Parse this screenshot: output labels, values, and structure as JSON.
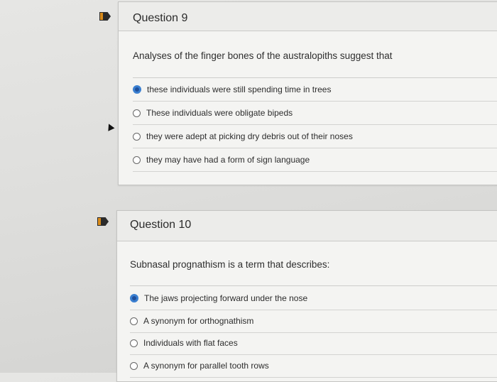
{
  "questions": [
    {
      "title": "Question 9",
      "prompt": "Analyses of the finger bones of the australopiths suggest that",
      "selected_index": 0,
      "options": [
        {
          "label": "these individuals were still spending time in trees"
        },
        {
          "label": "These individuals were obligate bipeds"
        },
        {
          "label": "they were adept at picking dry debris out of their noses"
        },
        {
          "label": "they may have had a form of sign language"
        }
      ]
    },
    {
      "title": "Question 10",
      "prompt": "Subnasal prognathism is a term that describes:",
      "selected_index": 0,
      "options": [
        {
          "label": "The jaws projecting forward under the nose"
        },
        {
          "label": "A synonym for orthognathism"
        },
        {
          "label": "Individuals with flat faces"
        },
        {
          "label": "A synonym for parallel tooth rows"
        }
      ]
    }
  ],
  "colors": {
    "flag": "#2b2b2b",
    "radio_selected": "#1f4f9a",
    "card_bg": "#f4f4f2"
  }
}
